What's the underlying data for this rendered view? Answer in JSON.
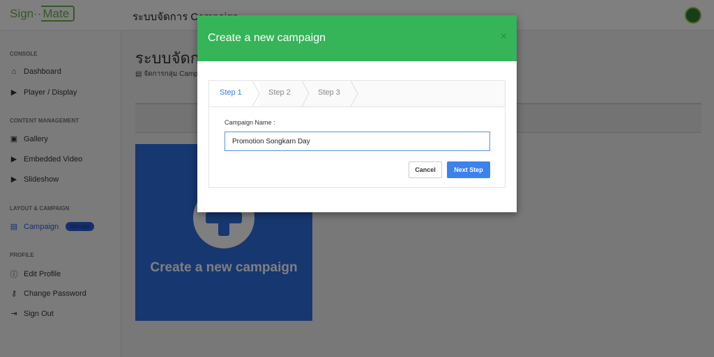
{
  "header": {
    "logo_left": "Sign",
    "logo_right": "Mate",
    "title": "ระบบจัดการ Campaign"
  },
  "sidebar": {
    "sections": [
      {
        "label": "CONSOLE",
        "items": [
          {
            "label": "Dashboard",
            "icon": "home-icon"
          },
          {
            "label": "Player / Display",
            "icon": "player-icon"
          }
        ]
      },
      {
        "label": "CONTENT MANAGEMENT",
        "items": [
          {
            "label": "Gallery",
            "icon": "gallery-icon"
          },
          {
            "label": "Embedded Video",
            "icon": "video-icon"
          },
          {
            "label": "Slideshow",
            "icon": "slideshow-icon"
          }
        ]
      },
      {
        "label": "LAYOUT & CAMPAIGN",
        "items": [
          {
            "label": "Campaign",
            "icon": "campaign-icon",
            "badge": "Manage",
            "active": true
          }
        ]
      },
      {
        "label": "PROFILE",
        "items": [
          {
            "label": "Edit Profile",
            "icon": "info-icon"
          },
          {
            "label": "Change Password",
            "icon": "key-icon"
          },
          {
            "label": "Sign Out",
            "icon": "sign-out-icon"
          }
        ]
      }
    ]
  },
  "main": {
    "title": "ระบบจัดการ Campaign",
    "subtitle": "จัดการกลุ่ม Campaign",
    "create_card": "Create a new campaign"
  },
  "modal": {
    "title": "Create a new campaign",
    "close": "×",
    "steps": [
      "Step 1",
      "Step 2",
      "Step 3"
    ],
    "active_step": 1,
    "field_label": "Campaign Name :",
    "field_value": "Promotion Songkarn Day",
    "cancel": "Cancel",
    "next": "Next Step"
  },
  "colors": {
    "modal_header": "#36b458",
    "accent": "#2f6fe0",
    "primary_button": "#3b82f0"
  }
}
